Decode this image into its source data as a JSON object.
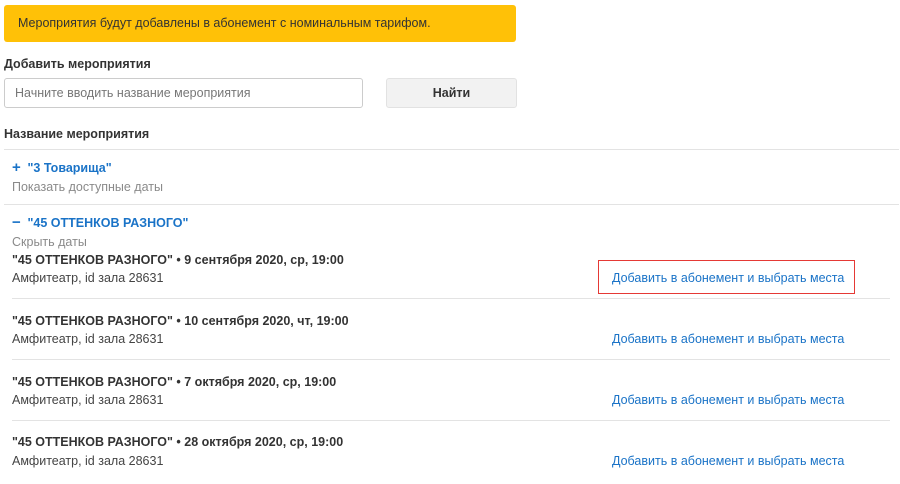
{
  "alert": {
    "text": "Мероприятия будут добавлены в абонемент с номинальным тарифом."
  },
  "search": {
    "label": "Добавить мероприятия",
    "placeholder": "Начните вводить название мероприятия",
    "value": "",
    "button_label": "Найти"
  },
  "list": {
    "header": "Название мероприятия",
    "events": [
      {
        "toggle_symbol": "+",
        "name": "\"3 Товарища\"",
        "sub_link": "Показать доступные даты",
        "expanded": false
      },
      {
        "toggle_symbol": "−",
        "name": "\"45 ОТТЕНКОВ РАЗНОГО\"",
        "sub_link": "Скрыть даты",
        "expanded": true,
        "sessions": [
          {
            "title": "\"45 ОТТЕНКОВ РАЗНОГО\"",
            "date": " • 9 сентября 2020, ср, 19:00",
            "venue": "Амфитеатр, id зала 28631",
            "action": "Добавить в абонемент и выбрать места",
            "highlighted": true
          },
          {
            "title": "\"45 ОТТЕНКОВ РАЗНОГО\"",
            "date": " • 10 сентября 2020, чт, 19:00",
            "venue": "Амфитеатр, id зала 28631",
            "action": "Добавить в абонемент и выбрать места",
            "highlighted": false
          },
          {
            "title": "\"45 ОТТЕНКОВ РАЗНОГО\"",
            "date": " • 7 октября 2020, ср, 19:00",
            "venue": "Амфитеатр, id зала 28631",
            "action": "Добавить в абонемент и выбрать места",
            "highlighted": false
          },
          {
            "title": "\"45 ОТТЕНКОВ РАЗНОГО\"",
            "date": " • 28 октября 2020, ср, 19:00",
            "venue": "Амфитеатр, id зала 28631",
            "action": "Добавить в абонемент и выбрать места",
            "highlighted": false
          }
        ]
      }
    ]
  },
  "colors": {
    "alert_bg": "#ffc107",
    "link": "#1a73c7",
    "highlight": "#e53935"
  }
}
